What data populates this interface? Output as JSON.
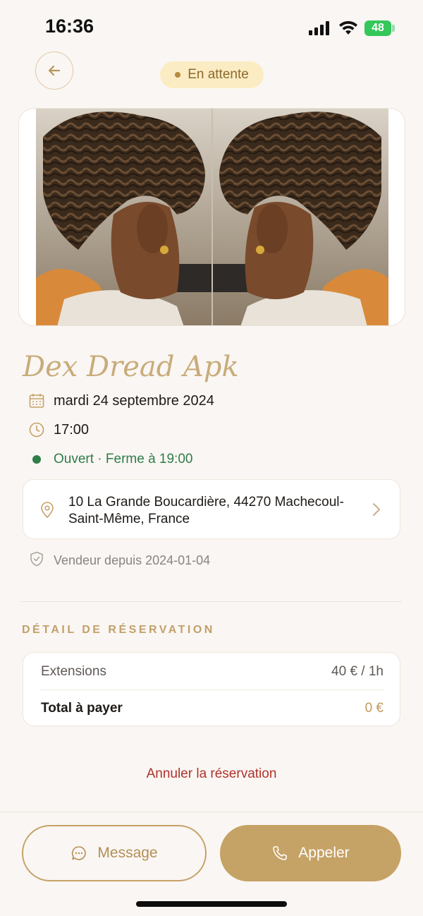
{
  "status_bar": {
    "time": "16:36",
    "battery": "48"
  },
  "header": {
    "back_icon": "arrow-left-icon",
    "status_badge": "En attente"
  },
  "shop": {
    "name": "Dex Dread Apk",
    "date": "mardi 24 septembre 2024",
    "time": "17:00",
    "open_status": "Ouvert · Ferme à 19:00",
    "address": "10 La Grande Boucardière, 44270 Machecoul-Saint-Même, France",
    "seller_since": "Vendeur depuis 2024-01-04"
  },
  "reservation": {
    "section_title": "DÉTAIL DE RÉSERVATION",
    "service_name": "Extensions",
    "service_price": "40 € / 1h",
    "total_label": "Total à payer",
    "total_value": "0 €"
  },
  "actions": {
    "cancel": "Annuler la réservation",
    "message": "Message",
    "call": "Appeler"
  },
  "colors": {
    "accent": "#c5a265",
    "background": "#faf6f3",
    "open_green": "#2f7d48",
    "cancel_red": "#b0322b",
    "badge_bg": "#fbecc4"
  }
}
